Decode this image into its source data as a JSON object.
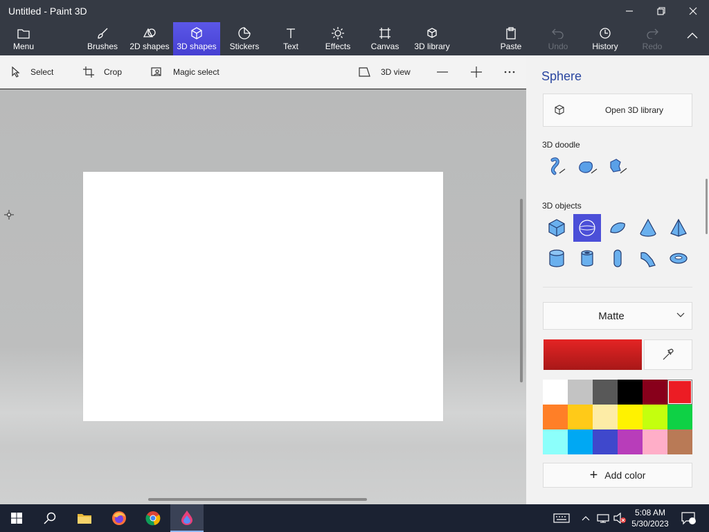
{
  "window": {
    "title": "Untitled - Paint 3D"
  },
  "ribbon": {
    "menu": "Menu",
    "brushes": "Brushes",
    "shapes_2d": "2D shapes",
    "shapes_3d": "3D shapes",
    "stickers": "Stickers",
    "text": "Text",
    "effects": "Effects",
    "canvas": "Canvas",
    "library_3d": "3D library",
    "paste": "Paste",
    "undo": "Undo",
    "history": "History",
    "redo": "Redo"
  },
  "toolbar": {
    "select": "Select",
    "crop": "Crop",
    "magic_select": "Magic select",
    "view_3d": "3D view"
  },
  "panel": {
    "title": "Sphere",
    "open_library": "Open 3D library",
    "doodle_label": "3D doodle",
    "objects_label": "3D objects",
    "material": "Matte",
    "add_color": "Add color",
    "selected_object": "sphere",
    "current_color": "#e42424",
    "palette": [
      "#ffffff",
      "#c3c3c3",
      "#585858",
      "#000000",
      "#88001b",
      "#ec1c24",
      "#ff7f27",
      "#ffca18",
      "#fdeca6",
      "#fff200",
      "#c4ff0e",
      "#0ed145",
      "#8cfffb",
      "#00a8f3",
      "#3f48cc",
      "#b83dba",
      "#ffaec8",
      "#b97a56"
    ]
  },
  "taskbar": {
    "time": "5:08 AM",
    "date": "5/30/2023",
    "notification_count": "1"
  }
}
